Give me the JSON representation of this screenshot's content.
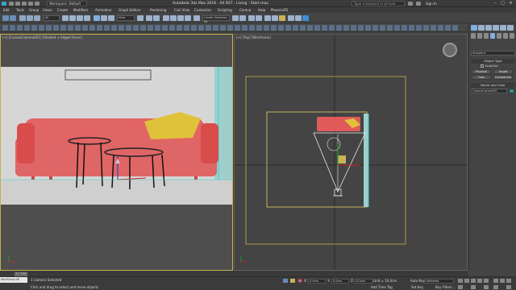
{
  "titlebar": {
    "workspace": "Workspace: Default",
    "title": "Autodesk 3ds Max 2016 - 04 RST - Living - Start.max",
    "search_placeholder": "Type a keyword or phrase",
    "signin": "Sign In"
  },
  "menu": [
    "Edit",
    "Tools",
    "Group",
    "Views",
    "Create",
    "Modifiers",
    "Animation",
    "Graph Editors",
    "Rendering",
    "Civil View",
    "Customize",
    "Scripting",
    "Corona",
    "Help",
    "PhoenixFD"
  ],
  "toolbar": {
    "selection_filter": "All",
    "view_select": "View",
    "named_set": "Create Selection Se"
  },
  "viewports": {
    "left_label": "[+] [CoronaCamera001] [Shaded + Edged Faces]",
    "right_label": "[+] [Top] [Wireframe]"
  },
  "command_panel": {
    "category": "Standard",
    "rollout_object_type": "Object Type",
    "autogrid": "AutoGrid",
    "buttons": [
      "Physical",
      "Target",
      "Free",
      "CoronaCam"
    ],
    "rollout_name_color": "Name and Color",
    "object_name": "CoronaCamera001"
  },
  "timeslider": {
    "frame": "0 / 100"
  },
  "status": {
    "script_listener": "MAXScript Mi",
    "selection": "1 Camera Selected",
    "prompt": "Click and drag to select and move objects",
    "x_value": "0.0cm",
    "y_value": "0.0cm",
    "z_value": "0.0cm",
    "grid": "Grid = 10.0cm",
    "add_time_tag": "Add Time Tag",
    "autokey": "Auto Key",
    "setkey": "Set Key",
    "selected": "Selected",
    "key_filters": "Key Filters..."
  },
  "colors": {
    "viewport_active_border": "#c8b14a",
    "sofa": "#e05a5a",
    "pillow": "#e0c23a",
    "camera_gizmo": "#e8e8e8",
    "highlight_circle": "#e02020"
  }
}
